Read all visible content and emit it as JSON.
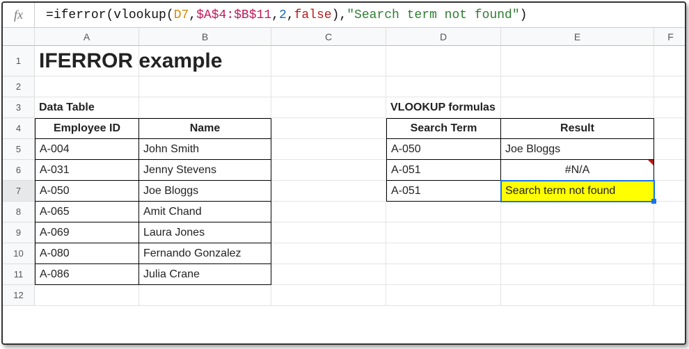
{
  "formula_bar": {
    "fx_label": "fx",
    "t0": "=",
    "t1": "iferror",
    "t2": "(",
    "t3": "vlookup",
    "t4": "(",
    "t5": "D7",
    "t6": ",",
    "t7": "$A$4:$B$11",
    "t8": ",",
    "t9": "2",
    "t10": ",",
    "t11": "false",
    "t12": ")",
    "t13": ",",
    "t14": "\"Search term not found\"",
    "t15": ")"
  },
  "columns": {
    "A": "A",
    "B": "B",
    "C": "C",
    "D": "D",
    "E": "E",
    "F": "F"
  },
  "rows": {
    "r1": "1",
    "r2": "2",
    "r3": "3",
    "r4": "4",
    "r5": "5",
    "r6": "6",
    "r7": "7",
    "r8": "8",
    "r9": "9",
    "r10": "10",
    "r11": "11",
    "r12": "12"
  },
  "cells": {
    "A1": "IFERROR example",
    "A3": "Data Table",
    "D3": "VLOOKUP formulas",
    "A4": "Employee ID",
    "B4": "Name",
    "D4": "Search Term",
    "E4": "Result",
    "data": [
      {
        "id": "A-004",
        "name": "John Smith"
      },
      {
        "id": "A-031",
        "name": "Jenny Stevens"
      },
      {
        "id": "A-050",
        "name": "Joe Bloggs"
      },
      {
        "id": "A-065",
        "name": "Amit Chand"
      },
      {
        "id": "A-069",
        "name": "Laura Jones"
      },
      {
        "id": "A-080",
        "name": "Fernando Gonzalez"
      },
      {
        "id": "A-086",
        "name": "Julia Crane"
      }
    ],
    "lookup": [
      {
        "term": "A-050",
        "result": "Joe Bloggs"
      },
      {
        "term": "A-051",
        "result": "#N/A"
      },
      {
        "term": "A-051",
        "result": "Search term not found"
      }
    ]
  },
  "selected_cell": "E7",
  "chart_data": {
    "type": "table",
    "tables": [
      {
        "title": "Data Table",
        "columns": [
          "Employee ID",
          "Name"
        ],
        "rows": [
          [
            "A-004",
            "John Smith"
          ],
          [
            "A-031",
            "Jenny Stevens"
          ],
          [
            "A-050",
            "Joe Bloggs"
          ],
          [
            "A-065",
            "Amit Chand"
          ],
          [
            "A-069",
            "Laura Jones"
          ],
          [
            "A-080",
            "Fernando Gonzalez"
          ],
          [
            "A-086",
            "Julia Crane"
          ]
        ]
      },
      {
        "title": "VLOOKUP formulas",
        "columns": [
          "Search Term",
          "Result"
        ],
        "rows": [
          [
            "A-050",
            "Joe Bloggs"
          ],
          [
            "A-051",
            "#N/A"
          ],
          [
            "A-051",
            "Search term not found"
          ]
        ]
      }
    ]
  }
}
